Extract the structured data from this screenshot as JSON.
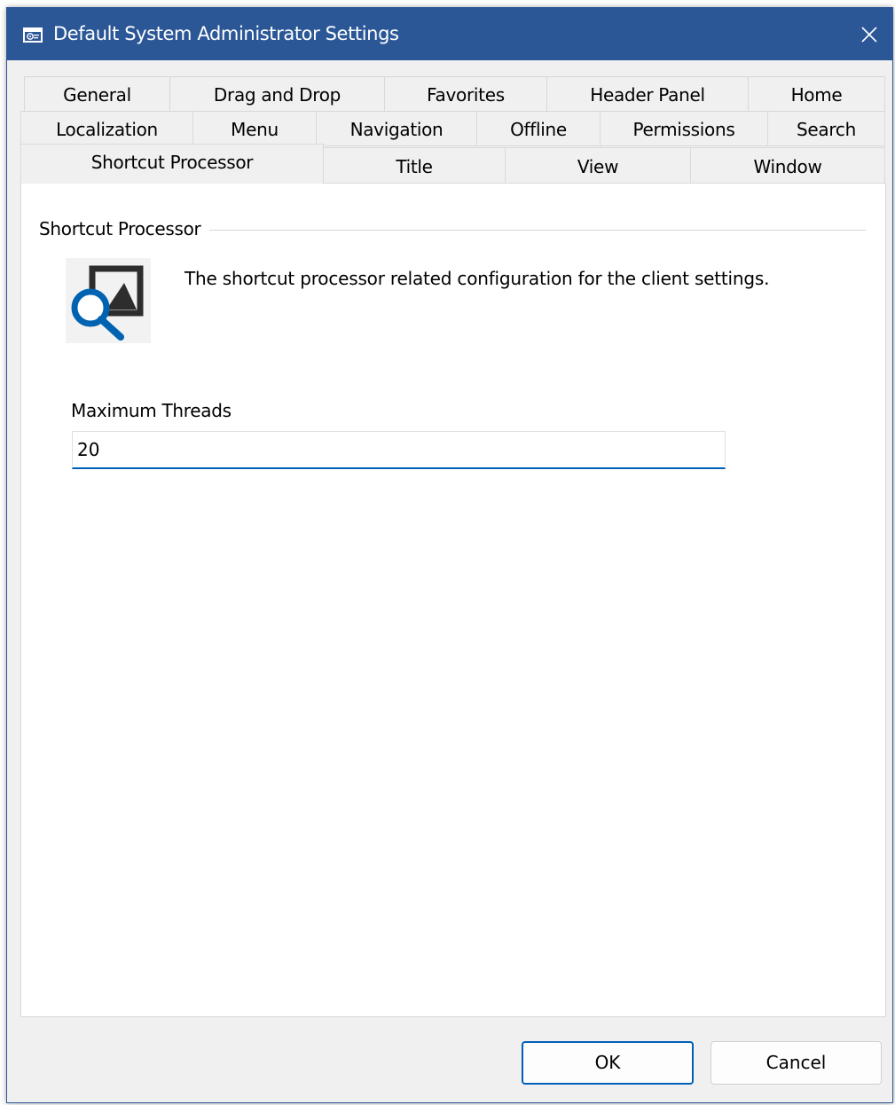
{
  "window": {
    "title": "Default System Administrator Settings"
  },
  "tabs": {
    "row1": [
      "General",
      "Drag and Drop",
      "Favorites",
      "Header Panel",
      "Home"
    ],
    "row2": [
      "Localization",
      "Menu",
      "Navigation",
      "Offline",
      "Permissions",
      "Search"
    ],
    "row3": [
      "Shortcut Processor",
      "Title",
      "View",
      "Window"
    ],
    "active": "Shortcut Processor"
  },
  "section": {
    "group_title": "Shortcut Processor",
    "description": "The shortcut processor related configuration for the client settings.",
    "icon": "image-search-icon"
  },
  "fields": {
    "max_threads_label": "Maximum Threads",
    "max_threads_value": "20"
  },
  "buttons": {
    "ok": "OK",
    "cancel": "Cancel"
  },
  "colors": {
    "titlebar": "#2b5797",
    "accent": "#005fb8",
    "icon_blue": "#0063b1",
    "icon_dark": "#2d2d2d"
  }
}
